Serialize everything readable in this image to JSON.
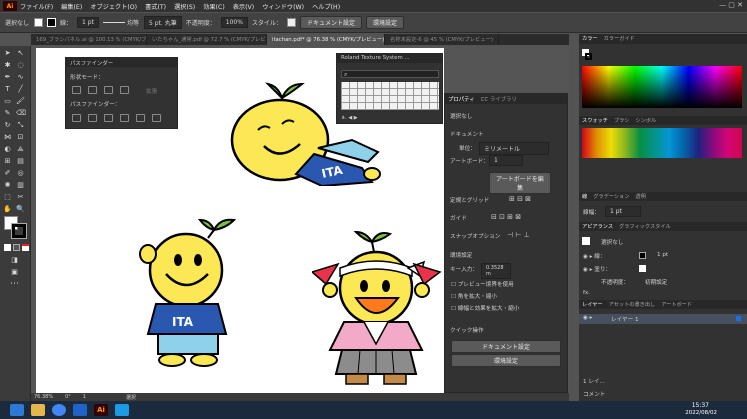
{
  "menubar": {
    "logo": "Ai",
    "items": [
      "ファイル(F)",
      "編集(E)",
      "オブジェクト(O)",
      "書式(T)",
      "選択(S)",
      "効果(C)",
      "表示(V)",
      "ウィンドウ(W)",
      "ヘルプ(H)"
    ]
  },
  "control": {
    "selection": "選択なし",
    "stroke_label": "線：",
    "stroke_value": "1 pt",
    "profile": "均等",
    "brush": "5 pt. 丸筆",
    "opacity_label": "不透明度：",
    "opacity_value": "100%",
    "style_label": "スタイル：",
    "doc_setup": "ドキュメント設定",
    "prefs": "環境設定"
  },
  "tabs": [
    "169_ブラシパネル.ai @ 100.13 % (CMYK/プレビュー)",
    "いたちゃん_通常.pdf @ 72.7 % (CMYK/プレビュー)",
    "itachan.pdf* @ 76.38 % (CMYK/プレビュー)",
    "名称未設定-6 @ 45 % (CMYK/プレビュー)"
  ],
  "pathfinder": {
    "title": "パスファインダー",
    "shape_modes": "形状モード：",
    "apply": "拡張",
    "pathfinders": "パスファインダー："
  },
  "brush_panel": {
    "title": "Roland Texture System ..."
  },
  "properties": {
    "tabs": [
      "プロパティ",
      "CC ライブラリ"
    ],
    "no_selection": "選択なし",
    "document": "ドキュメント",
    "units_label": "単位：",
    "units_value": "ミリメートル",
    "artboard_label": "アートボード：",
    "artboard_value": "1",
    "edit_artboard": "アートボードを編集",
    "rulers_grids": "定規とグリッド",
    "guides": "ガイド",
    "snap": "スナップオプション",
    "prefs_heading": "環境設定",
    "key_label": "キー入力：",
    "key_value": "0.3528 m",
    "chk_preview": "プレビュー境界を使用",
    "chk_scale_corners": "角を拡大・縮小",
    "chk_scale_strokes": "線幅と効果を拡大・縮小",
    "quick_actions": "クイック操作",
    "doc_setup_btn": "ドキュメント設定",
    "prefs_btn": "環境設定"
  },
  "right": {
    "color_tabs": [
      "カラー",
      "カラーガイド"
    ],
    "swatch_tabs": [
      "スウォッチ",
      "ブラシ",
      "シンボル"
    ],
    "stroke_tabs": [
      "線",
      "グラデーション",
      "透明"
    ],
    "stroke_width_label": "線幅：",
    "stroke_width_value": "1 pt",
    "appearance_tabs": [
      "アピアランス",
      "グラフィックスタイル"
    ],
    "appearance_none": "選択なし",
    "stroke": "線：",
    "stroke_val": "1 pt",
    "fill": "塗り：",
    "opacity": "不透明度：",
    "opacity_val": "初期設定",
    "fx": "fx.",
    "layer_tabs": [
      "レイヤー",
      "アセットの書き出し",
      "アートボード"
    ],
    "layer_name": "レイヤー 1",
    "layer_count": "1 レイ...",
    "comment": "コメント"
  },
  "status": {
    "zoom": "76.38%",
    "angle": "0°",
    "page": "1",
    "tool": "選択"
  },
  "taskbar": {
    "time": "15:37",
    "date": "2022/08/02"
  },
  "colors": {
    "accent": "#1473e6",
    "ai_orange": "#ff9a00"
  }
}
